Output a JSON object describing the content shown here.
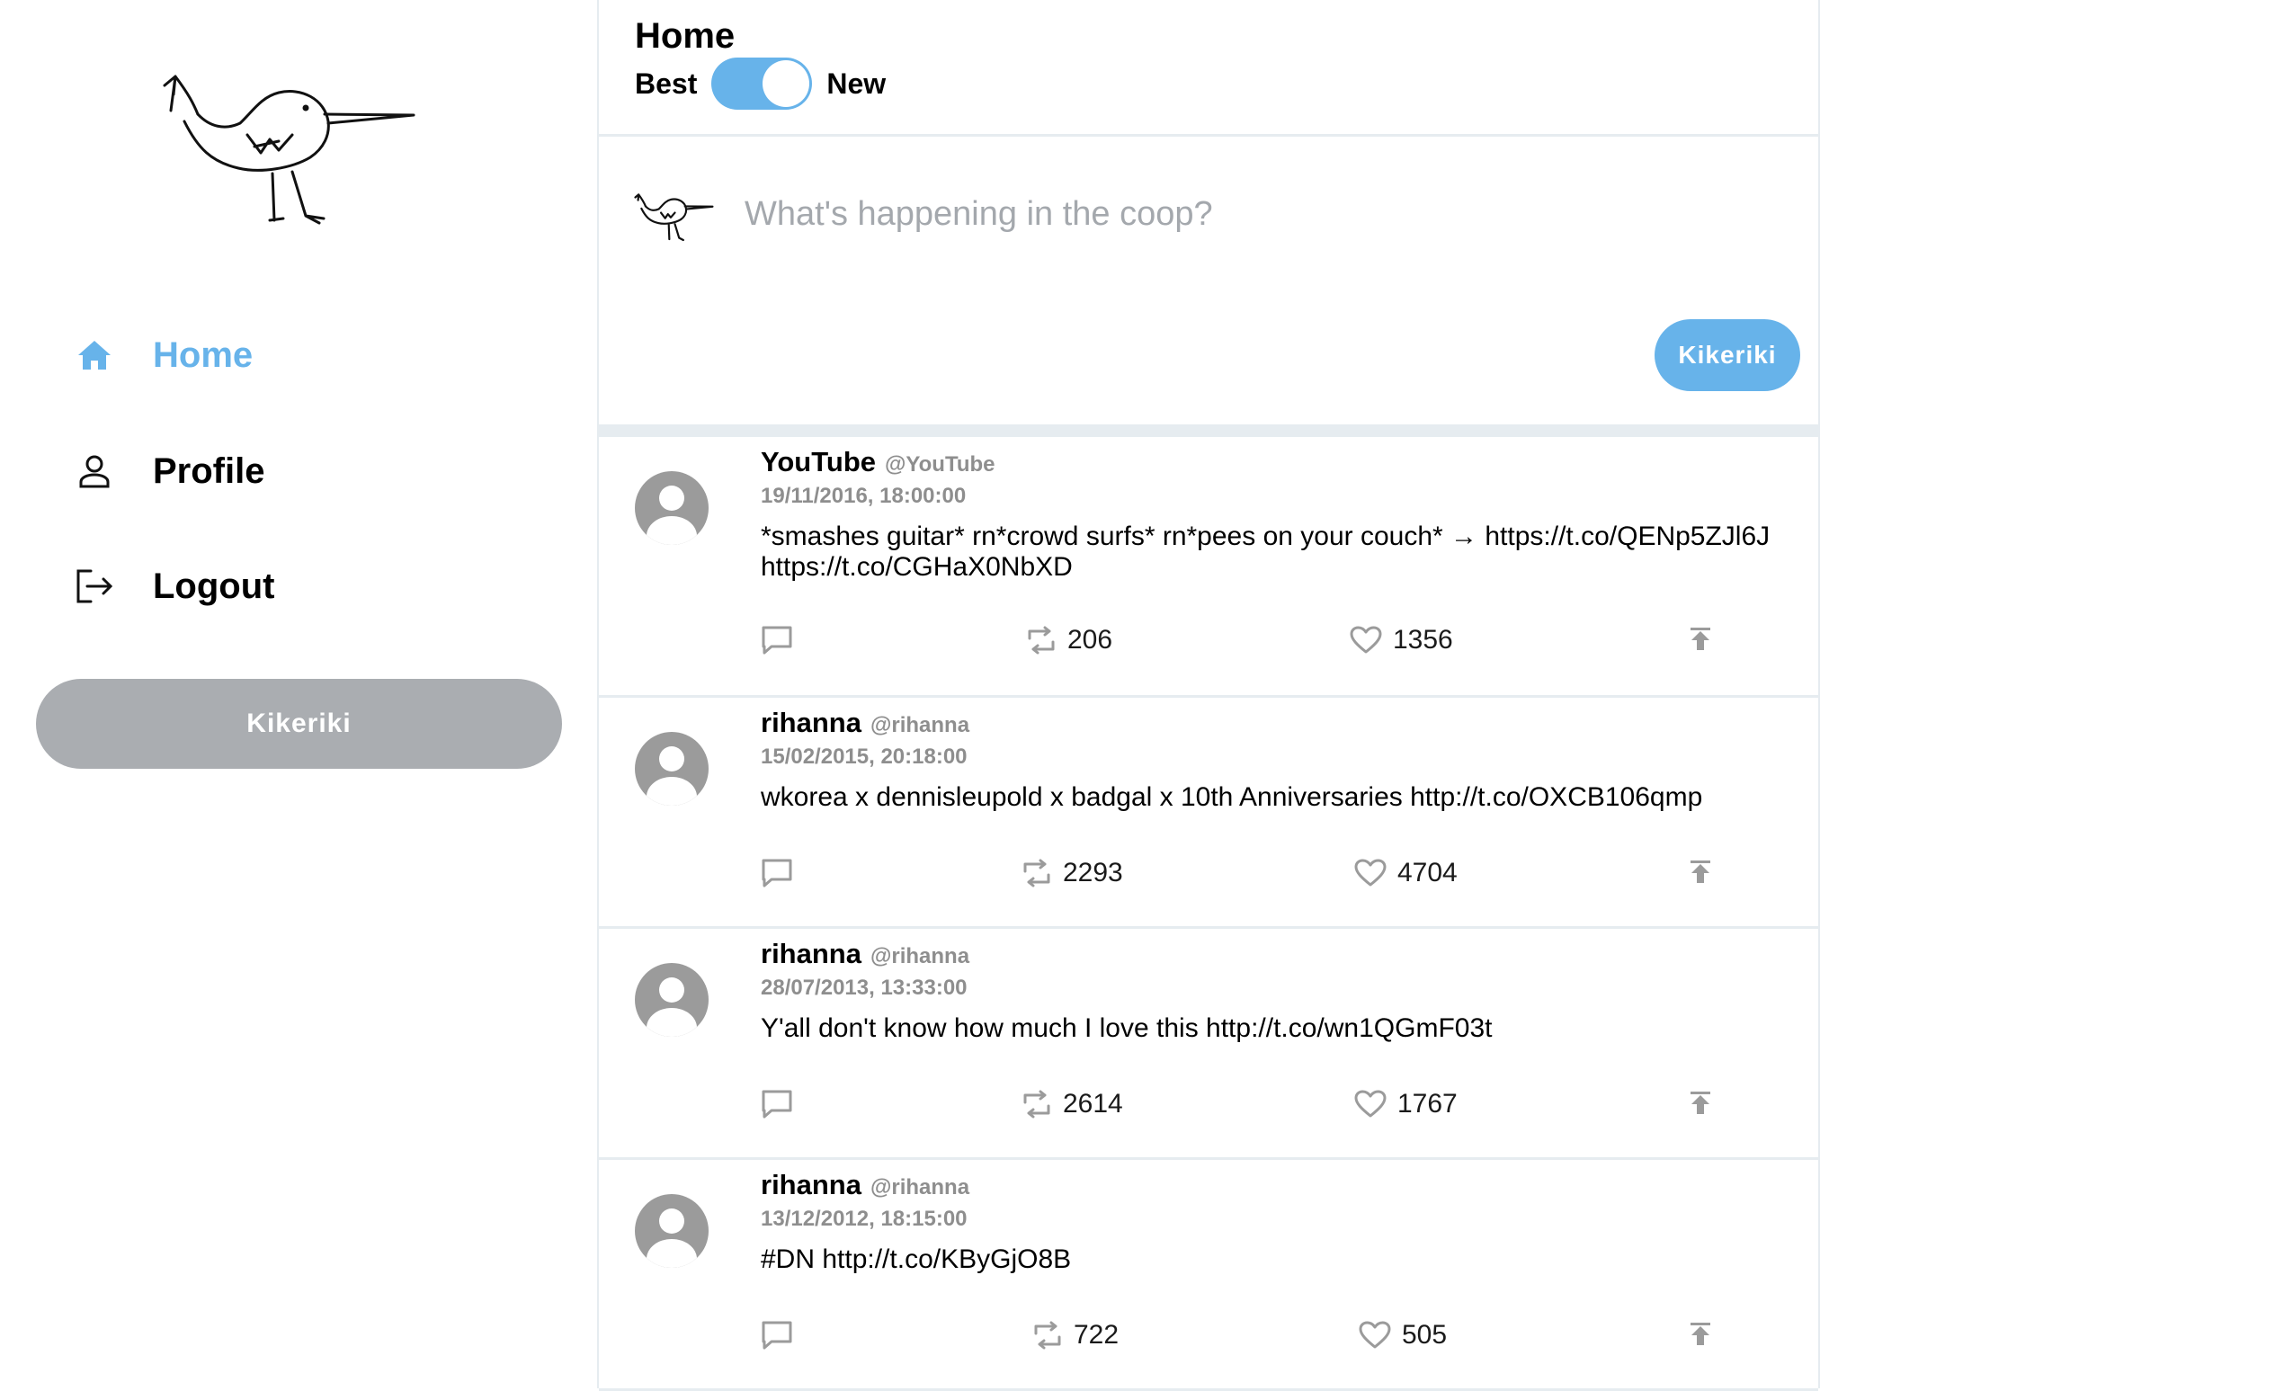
{
  "sidebar": {
    "nav": [
      {
        "label": "Home",
        "icon": "home-icon",
        "active": true
      },
      {
        "label": "Profile",
        "icon": "person-icon",
        "active": false
      },
      {
        "label": "Logout",
        "icon": "logout-icon",
        "active": false
      }
    ],
    "post_button_label": "Kikeriki"
  },
  "header": {
    "title": "Home",
    "toggle_left": "Best",
    "toggle_right": "New",
    "toggle_on": true
  },
  "composer": {
    "placeholder": "What's happening in the coop?",
    "submit_label": "Kikeriki"
  },
  "tweets": [
    {
      "name": "YouTube",
      "handle": "@YouTube",
      "date": "19/11/2016, 18:00:00",
      "text": "*smashes guitar* rn*crowd surfs* rn*pees on your couch* → https://t.co/QENp5ZJl6J https://t.co/CGHaX0NbXD",
      "retweets": "206",
      "likes": "1356"
    },
    {
      "name": "rihanna",
      "handle": "@rihanna",
      "date": "15/02/2015, 20:18:00",
      "text": "wkorea x dennisleupold x badgal x 10th Anniversaries http://t.co/OXCB106qmp",
      "retweets": "2293",
      "likes": "4704"
    },
    {
      "name": "rihanna",
      "handle": "@rihanna",
      "date": "28/07/2013, 13:33:00",
      "text": "Y'all don't know how much I love this http://t.co/wn1QGmF03t",
      "retweets": "2614",
      "likes": "1767"
    },
    {
      "name": "rihanna",
      "handle": "@rihanna",
      "date": "13/12/2012, 18:15:00",
      "text": "#DN http://t.co/KByGjO8B",
      "retweets": "722",
      "likes": "505"
    }
  ],
  "colors": {
    "accent": "#67b3ea",
    "muted": "#aaadb1",
    "divider": "#e6ecf0"
  }
}
